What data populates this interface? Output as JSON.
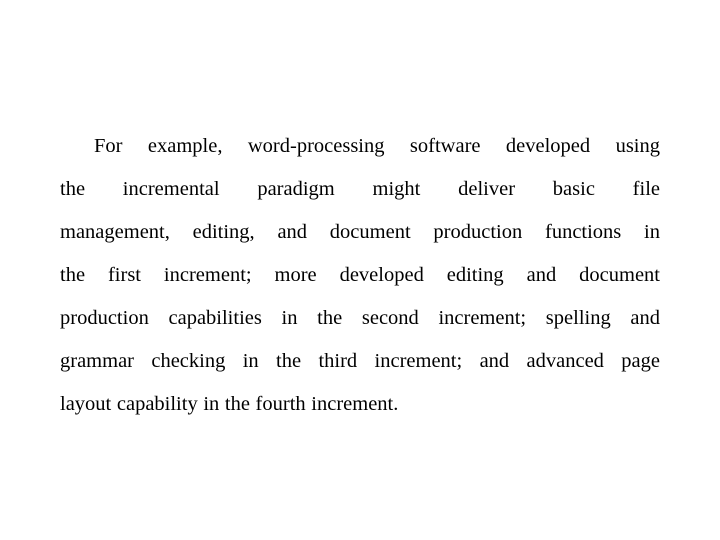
{
  "slide": {
    "background_color": "#ffffff",
    "text_color": "#000000",
    "paragraph_lines": [
      "For example, word-processing software developed using",
      "the incremental paradigm might deliver basic file",
      "management, editing, and document production functions in",
      "the first increment; more developed editing and document",
      "production capabilities in the second increment; spelling and",
      "grammar checking in the third increment; and advanced page",
      "layout capability in the fourth increment."
    ],
    "full_text": "For example, word-processing software developed using the incremental paradigm might deliver basic file management, editing, and document production functions in the first increment; more developed editing and document production capabilities in the second increment; spelling and grammar checking in the third increment; and advanced page layout capability in the fourth increment."
  }
}
